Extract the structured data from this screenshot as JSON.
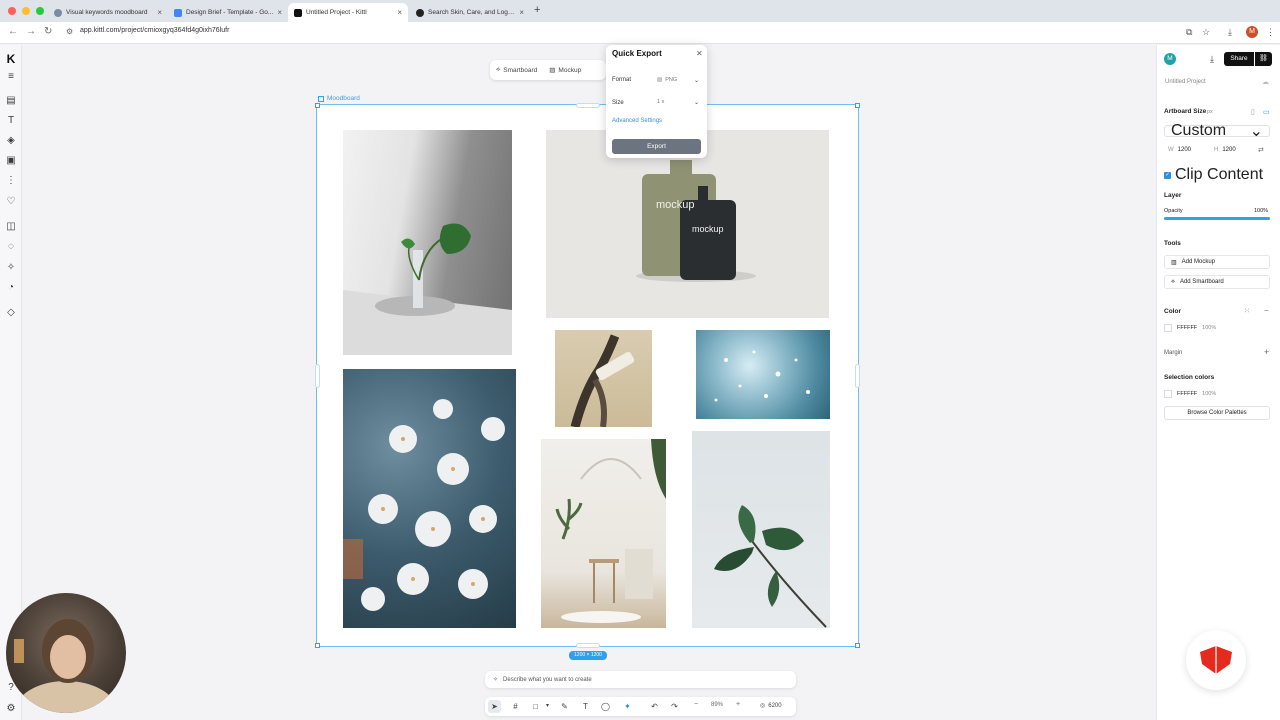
{
  "browser": {
    "tabs": [
      {
        "title": "Visual keywords moodboard",
        "favicon": "globe-icon"
      },
      {
        "title": "Design Brief - Template - Go...",
        "favicon": "docs-icon"
      },
      {
        "title": "Untitled Project - Kittl",
        "favicon": "kittl-icon"
      },
      {
        "title": "Search Skin, Care, and Logo...",
        "favicon": "search-icon"
      }
    ],
    "url": "app.kittl.com/project/cmioxgyq364fd4g0ixh76lufr",
    "profile_initial": "M"
  },
  "canvas": {
    "mode_tabs": [
      "Smartboard",
      "Mockup"
    ],
    "board_label": "Moodboard",
    "size_badge": "1200 × 1200",
    "mockup_text_1": "mockup",
    "mockup_text_2": "mockup"
  },
  "quick_export": {
    "title": "Quick Export",
    "format_label": "Format",
    "format_value": "PNG",
    "size_label": "Size",
    "size_value": "1 x",
    "advanced_label": "Advanced Settings",
    "export_button": "Export"
  },
  "prompt": {
    "placeholder": "Describe what you want to create"
  },
  "bottombar": {
    "zoom": "89%",
    "credits": "6200"
  },
  "rightpanel": {
    "user_initial": "M",
    "share_label": "Share",
    "project_name": "Untitled Project",
    "artboard_size_label": "Artboard Size",
    "artboard_unit": "px",
    "preset": "Custom",
    "w_label": "W",
    "w_value": "1200",
    "h_label": "H",
    "h_value": "1200",
    "clip_content": "Clip Content",
    "layer_heading": "Layer",
    "opacity_label": "Opacity",
    "opacity_value": "100%",
    "tools_heading": "Tools",
    "add_mockup": "Add Mockup",
    "add_smartboard": "Add Smartboard",
    "color_heading": "Color",
    "color_hex": "FFFFFF",
    "color_opacity": "100%",
    "margin_heading": "Margin",
    "selection_heading": "Selection colors",
    "selection_hex": "FFFFFF",
    "selection_opacity": "100%",
    "browse_palettes": "Browse Color Palettes"
  },
  "colors": {
    "accent": "#2ea1ea",
    "export_button": "#6b7480",
    "brand_red": "#e52a1e"
  }
}
